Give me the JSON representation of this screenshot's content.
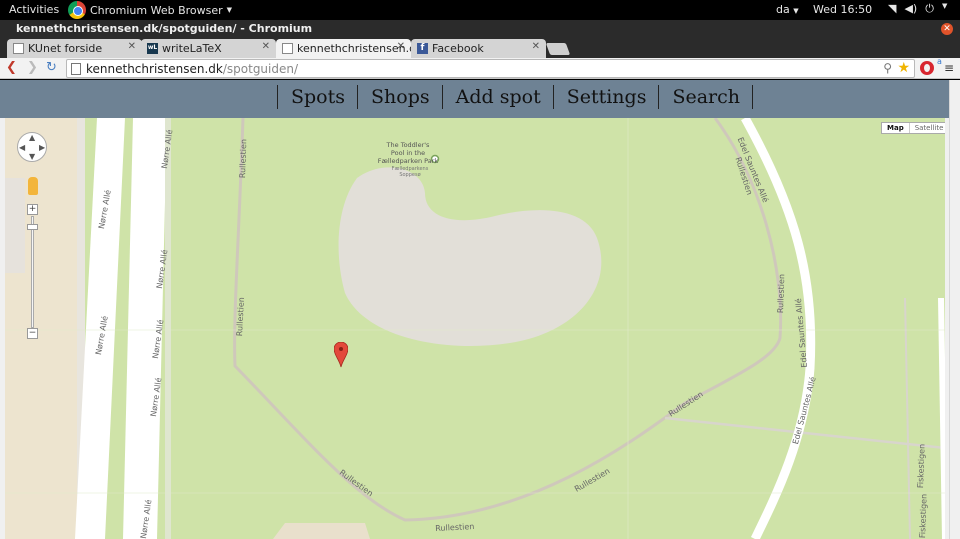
{
  "topbar": {
    "activities": "Activities",
    "app_name": "Chromium Web Browser",
    "language": "da",
    "clock": "Wed 16:50"
  },
  "window": {
    "title": "kennethchristensen.dk/spotguiden/ - Chromium"
  },
  "tabs": [
    {
      "label": "KUnet forside",
      "icon": "page-icon",
      "active": false
    },
    {
      "label": "writeLaTeX",
      "icon": "writelatex-icon",
      "active": false
    },
    {
      "label": "kennethchristensen.d",
      "icon": "page-icon",
      "active": true
    },
    {
      "label": "Facebook",
      "icon": "facebook-icon",
      "active": false
    }
  ],
  "omnibox": {
    "domain": "kennethchristensen.dk",
    "path": "/spotguiden/"
  },
  "site_nav": {
    "items": [
      "Spots",
      "Shops",
      "Add spot",
      "Settings",
      "Search"
    ]
  },
  "map": {
    "type_control": {
      "selected": "Map",
      "other": "Satellite"
    },
    "poi": {
      "name_lines": [
        "The Toddler's",
        "Pool in the",
        "Fælledparken Park"
      ],
      "sub_lines": [
        "Fælledparkens",
        "Soppesø"
      ]
    },
    "streets": {
      "norre_alle": "Nørre Allé",
      "rullestien": "Rullestien",
      "edel_saunte": "Edel Sauntes Allé",
      "fisk": "Fiskestigen"
    },
    "marker_color": "#e3493b"
  },
  "colors": {
    "park": "#cfe3a8",
    "pond": "#e2dfd8",
    "site_nav_bg": "#6e8294"
  }
}
